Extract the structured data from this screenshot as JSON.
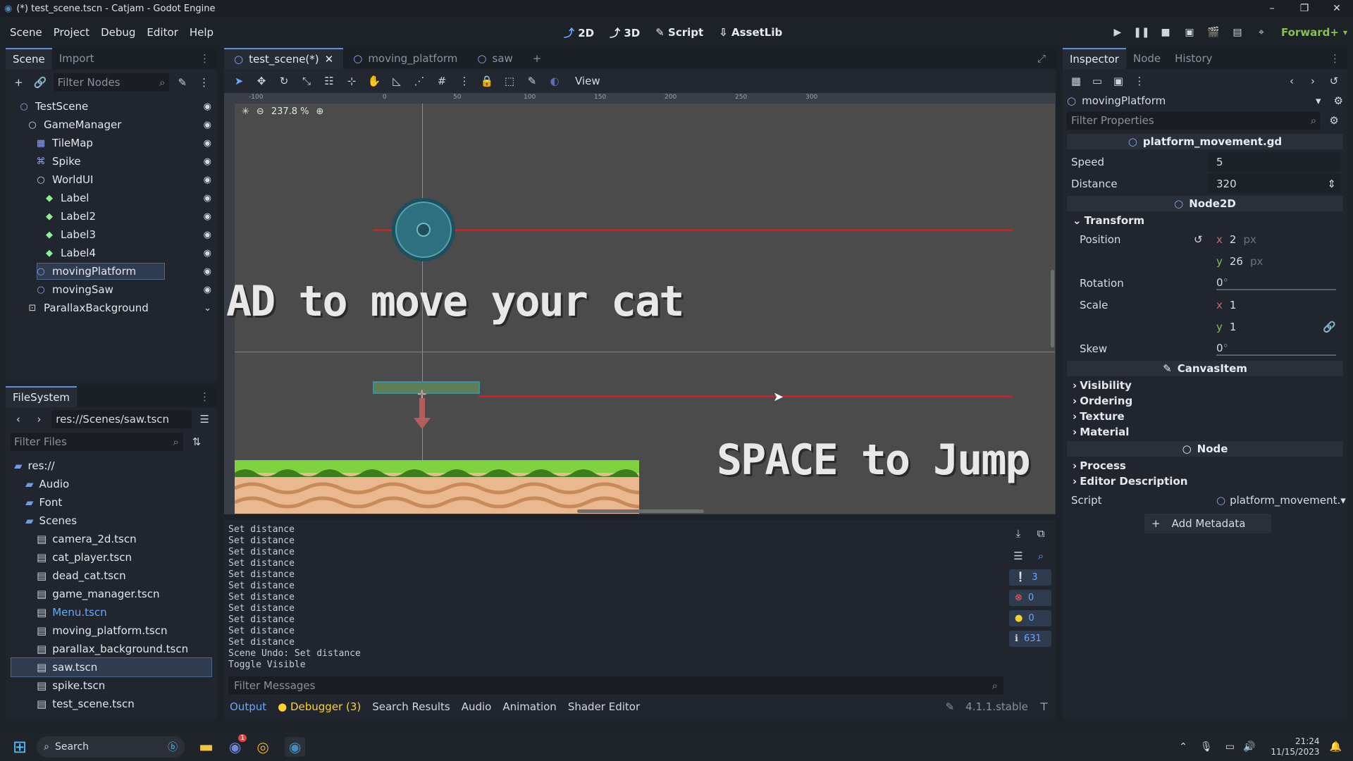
{
  "window": {
    "title": "(*) test_scene.tscn - Catjam - Godot Engine"
  },
  "menu": [
    "Scene",
    "Project",
    "Debug",
    "Editor",
    "Help"
  ],
  "workspaces": [
    {
      "label": "2D",
      "icon": "2d-icon",
      "active": true
    },
    {
      "label": "3D",
      "icon": "3d-icon",
      "active": false
    },
    {
      "label": "Script",
      "icon": "script-icon",
      "active": false
    },
    {
      "label": "AssetLib",
      "icon": "assetlib-icon",
      "active": false
    }
  ],
  "renderer": "Forward+",
  "scene_dock": {
    "tabs": [
      "Scene",
      "Import"
    ],
    "filter_placeholder": "Filter Nodes",
    "nodes": [
      {
        "name": "TestScene",
        "depth": 0,
        "icon": "node2d-icon",
        "color": "#8da5f3"
      },
      {
        "name": "GameManager",
        "depth": 1,
        "icon": "node2d-icon",
        "color": "#d6d6d6"
      },
      {
        "name": "TileMap",
        "depth": 2,
        "icon": "tilemap-icon",
        "color": "#8da5f3"
      },
      {
        "name": "Spike",
        "depth": 2,
        "icon": "area2d-icon",
        "color": "#8da5f3"
      },
      {
        "name": "WorldUI",
        "depth": 2,
        "icon": "node-icon",
        "color": "#d6d6d6"
      },
      {
        "name": "Label",
        "depth": 3,
        "icon": "label-icon",
        "color": "#8eef97"
      },
      {
        "name": "Label2",
        "depth": 3,
        "icon": "label-icon",
        "color": "#8eef97"
      },
      {
        "name": "Label3",
        "depth": 3,
        "icon": "label-icon",
        "color": "#8eef97"
      },
      {
        "name": "Label4",
        "depth": 3,
        "icon": "label-icon",
        "color": "#8eef97"
      },
      {
        "name": "movingPlatform",
        "depth": 2,
        "icon": "node-icon",
        "color": "#8da5f3",
        "selected": true
      },
      {
        "name": "movingSaw",
        "depth": 2,
        "icon": "node-icon",
        "color": "#8da5f3"
      },
      {
        "name": "ParallaxBackground",
        "depth": 1,
        "icon": "parallax-icon",
        "color": "#d6d6d6"
      }
    ]
  },
  "filesystem": {
    "tab": "FileSystem",
    "path": "res://Scenes/saw.tscn",
    "filter_placeholder": "Filter Files",
    "items": [
      {
        "name": "res://",
        "depth": 0,
        "kind": "folder"
      },
      {
        "name": "Audio",
        "depth": 1,
        "kind": "folder"
      },
      {
        "name": "Font",
        "depth": 1,
        "kind": "folder"
      },
      {
        "name": "Scenes",
        "depth": 1,
        "kind": "folder"
      },
      {
        "name": "camera_2d.tscn",
        "depth": 2,
        "kind": "scene"
      },
      {
        "name": "cat_player.tscn",
        "depth": 2,
        "kind": "scene"
      },
      {
        "name": "dead_cat.tscn",
        "depth": 2,
        "kind": "scene"
      },
      {
        "name": "game_manager.tscn",
        "depth": 2,
        "kind": "scene"
      },
      {
        "name": "Menu.tscn",
        "depth": 2,
        "kind": "scene",
        "highlight": true
      },
      {
        "name": "moving_platform.tscn",
        "depth": 2,
        "kind": "scene"
      },
      {
        "name": "parallax_background.tscn",
        "depth": 2,
        "kind": "scene"
      },
      {
        "name": "saw.tscn",
        "depth": 2,
        "kind": "scene",
        "selected": true
      },
      {
        "name": "spike.tscn",
        "depth": 2,
        "kind": "scene"
      },
      {
        "name": "test_scene.tscn",
        "depth": 2,
        "kind": "scene"
      }
    ]
  },
  "editor": {
    "tabs": [
      {
        "label": "test_scene(*)",
        "active": true
      },
      {
        "label": "moving_platform",
        "active": false
      },
      {
        "label": "saw",
        "active": false
      }
    ],
    "view_label": "View",
    "zoom": "237.8 %",
    "ruler_ticks": [
      "-100",
      "0",
      "50",
      "100",
      "150",
      "200",
      "250",
      "300"
    ],
    "canvas_text_1": "AD to move your cat",
    "canvas_text_2": "SPACE to Jump"
  },
  "output": {
    "lines": [
      "Set distance",
      "Set distance",
      "Set distance",
      "Set distance",
      "Set distance",
      "Set distance",
      "Set distance",
      "Set distance",
      "Set distance",
      "Set distance",
      "Set distance",
      "Scene Undo: Set distance",
      "Toggle Visible"
    ],
    "filter_placeholder": "Filter Messages",
    "counts": {
      "messages": "3",
      "errors": "0",
      "warnings": "0",
      "info": "631"
    },
    "tabs": [
      "Output",
      "Debugger (3)",
      "Search Results",
      "Audio",
      "Animation",
      "Shader Editor"
    ],
    "version": "4.1.1.stable"
  },
  "inspector": {
    "tabs": [
      "Inspector",
      "Node",
      "History"
    ],
    "node_name": "movingPlatform",
    "filter_placeholder": "Filter Properties",
    "script_header": "platform_movement.gd",
    "speed_label": "Speed",
    "speed_value": "5",
    "distance_label": "Distance",
    "distance_value": "320",
    "node2d_header": "Node2D",
    "transform_label": "Transform",
    "position_label": "Position",
    "pos_x": "2",
    "pos_y": "26",
    "px_unit": "px",
    "rotation_label": "Rotation",
    "rotation_value": "0",
    "scale_label": "Scale",
    "scale_x": "1",
    "scale_y": "1",
    "skew_label": "Skew",
    "skew_value": "0",
    "deg_unit": "°",
    "canvasitem_header": "CanvasItem",
    "canvas_groups": [
      "Visibility",
      "Ordering",
      "Texture",
      "Material"
    ],
    "node_header": "Node",
    "node_groups": [
      "Process",
      "Editor Description"
    ],
    "script_label": "Script",
    "script_value": "platform_movement.",
    "add_metadata": "Add Metadata"
  },
  "taskbar": {
    "search_placeholder": "Search",
    "time": "21:24",
    "date": "11/15/2023",
    "discord_badge": "1"
  }
}
